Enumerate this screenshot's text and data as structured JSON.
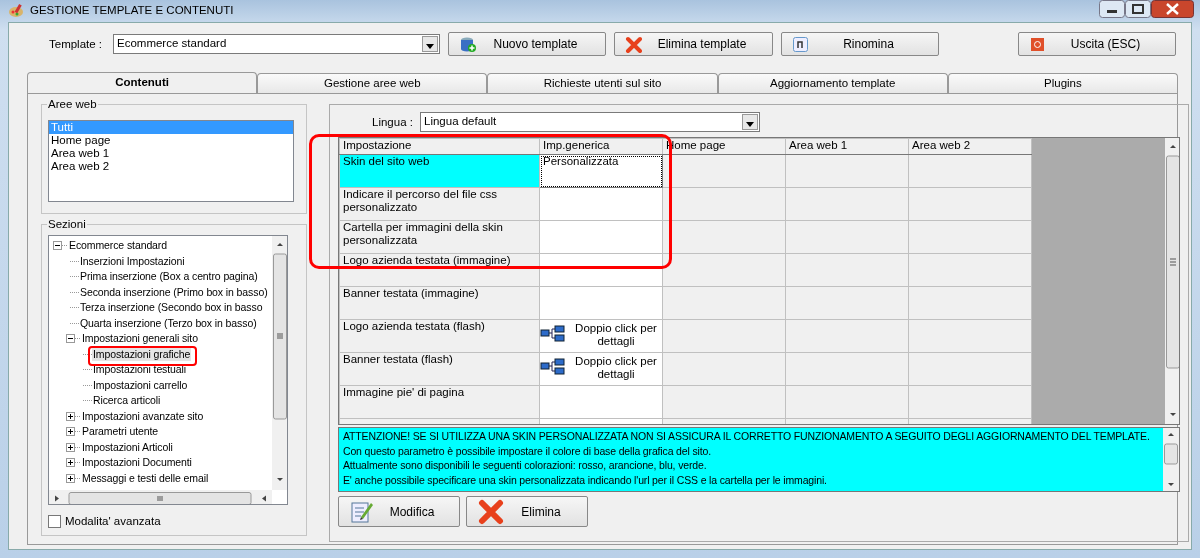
{
  "window": {
    "title": "GESTIONE TEMPLATE E CONTENUTI"
  },
  "template": {
    "label": "Template :",
    "value": "Ecommerce standard"
  },
  "toolbar": [
    {
      "label": "Nuovo template",
      "kind": "new"
    },
    {
      "label": "Elimina template",
      "kind": "delete"
    },
    {
      "label": "Rinomina",
      "kind": "rename"
    },
    {
      "label": "Uscita (ESC)",
      "kind": "exit"
    }
  ],
  "tabs": [
    {
      "label": "Contenuti",
      "selected": true
    },
    {
      "label": "Gestione aree web",
      "selected": false
    },
    {
      "label": "Richieste utenti sul sito",
      "selected": false
    },
    {
      "label": "Aggiornamento template",
      "selected": false
    },
    {
      "label": "Plugins",
      "selected": false
    }
  ],
  "aree_web": {
    "title": "Aree web",
    "items": [
      {
        "label": "Tutti",
        "selected": true
      },
      {
        "label": "Home page",
        "selected": false
      },
      {
        "label": "Area web 1",
        "selected": false
      },
      {
        "label": "Area web 2",
        "selected": false
      }
    ]
  },
  "sezioni": {
    "title": "Sezioni",
    "tree": [
      {
        "label": "Ecommerce standard",
        "expanded": true,
        "selected": false,
        "children": [
          {
            "label": "Inserzioni Impostazioni",
            "selected": false
          },
          {
            "label": "Prima inserzione (Box a centro pagina)",
            "selected": false
          },
          {
            "label": "Seconda inserzione (Primo box in basso)",
            "selected": false
          },
          {
            "label": "Terza inserzione (Secondo box in basso",
            "selected": false
          },
          {
            "label": "Quarta inserzione (Terzo box in basso)",
            "selected": false
          },
          {
            "label": "Impostazioni generali sito",
            "expanded": true,
            "selected": false,
            "children": [
              {
                "label": "Impostazioni grafiche",
                "selected": true
              },
              {
                "label": "Impostazioni testuali",
                "selected": false
              },
              {
                "label": "Impostazioni carrello",
                "selected": false
              },
              {
                "label": "Ricerca articoli",
                "selected": false
              }
            ]
          },
          {
            "label": "Impostazioni avanzate sito",
            "expanded": false,
            "selected": false
          },
          {
            "label": "Parametri utente",
            "expanded": false,
            "selected": false
          },
          {
            "label": "Impostazioni Articoli",
            "expanded": false,
            "selected": false
          },
          {
            "label": "Impostazioni Documenti",
            "expanded": false,
            "selected": false
          },
          {
            "label": "Messaggi e testi delle email",
            "expanded": false,
            "selected": false
          }
        ]
      }
    ]
  },
  "advanced_mode": {
    "label": "Modalita' avanzata",
    "checked": false
  },
  "lingua": {
    "label": "Lingua :",
    "value": "Lingua default"
  },
  "grid": {
    "columns": [
      "Impostazione",
      "Imp.generica",
      "Home page",
      "Area web 1",
      "Area web 2"
    ],
    "rows": [
      {
        "setting": "Skin del sito web",
        "selected": true,
        "generic": {
          "kind": "text",
          "text": "Personalizzata"
        }
      },
      {
        "setting": "Indicare il percorso del file css personalizzato",
        "selected": false,
        "generic": {
          "kind": "empty"
        }
      },
      {
        "setting": "Cartella per immagini della skin personalizzata",
        "selected": false,
        "generic": {
          "kind": "empty"
        }
      },
      {
        "setting": "Logo azienda testata (immagine)",
        "selected": false,
        "generic": {
          "kind": "empty"
        }
      },
      {
        "setting": "Banner testata (immagine)",
        "selected": false,
        "generic": {
          "kind": "empty"
        }
      },
      {
        "setting": "Logo azienda testata (flash)",
        "selected": false,
        "generic": {
          "kind": "details",
          "text": "Doppio click per dettagli"
        }
      },
      {
        "setting": "Banner testata (flash)",
        "selected": false,
        "generic": {
          "kind": "details",
          "text": "Doppio click per dettagli"
        }
      },
      {
        "setting": "Immagine pie' di pagina",
        "selected": false,
        "generic": {
          "kind": "empty"
        }
      }
    ]
  },
  "info": {
    "lines": [
      "ATTENZIONE! SE SI UTILIZZA UNA SKIN PERSONALIZZATA NON SI ASSICURA IL CORRETTO FUNZIONAMENTO A SEGUITO DEGLI AGGIORNAMENTO DEL TEMPLATE.",
      "Con questo parametro è possibile impostare il colore di base della grafica del sito.",
      "Attualmente sono disponibili le seguenti colorazioni: rosso, arancione, blu, verde.",
      "E' anche possibile specificare una skin personalizzata indicando l'url per il CSS e la cartella per le immagini."
    ]
  },
  "actions": [
    {
      "label": "Modifica",
      "kind": "edit"
    },
    {
      "label": "Elimina",
      "kind": "delete"
    }
  ]
}
